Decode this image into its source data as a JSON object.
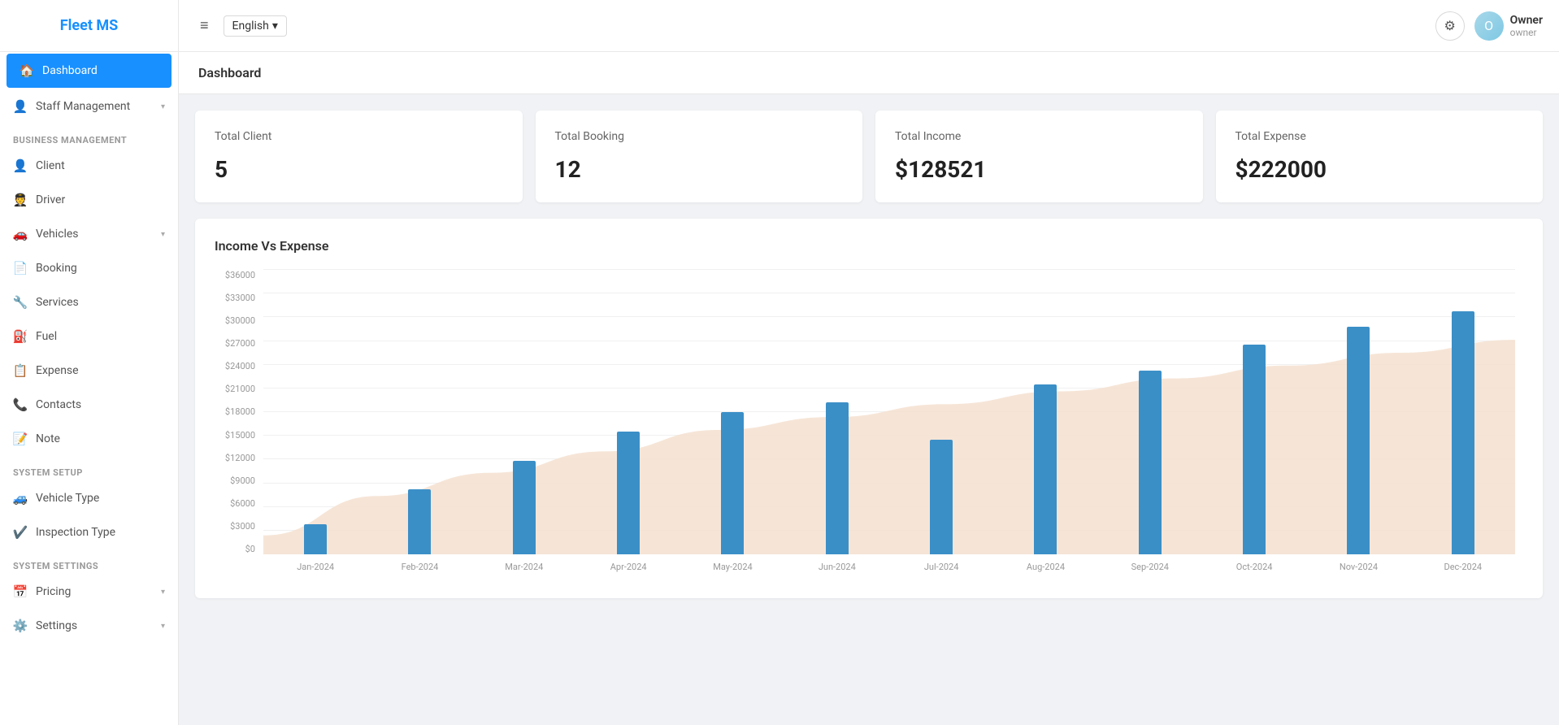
{
  "sidebar": {
    "logo": "Fleet MS",
    "items": [
      {
        "id": "dashboard",
        "label": "Dashboard",
        "icon": "🏠",
        "active": true,
        "hasArrow": false
      },
      {
        "id": "staff-management",
        "label": "Staff Management",
        "icon": "👤",
        "active": false,
        "hasArrow": true
      },
      {
        "id": "section-business",
        "label": "Business Management",
        "isSection": true
      },
      {
        "id": "client",
        "label": "Client",
        "icon": "👤",
        "active": false,
        "hasArrow": false
      },
      {
        "id": "driver",
        "label": "Driver",
        "icon": "🧑‍✈️",
        "active": false,
        "hasArrow": false
      },
      {
        "id": "vehicles",
        "label": "Vehicles",
        "icon": "🚗",
        "active": false,
        "hasArrow": true
      },
      {
        "id": "booking",
        "label": "Booking",
        "icon": "📄",
        "active": false,
        "hasArrow": false
      },
      {
        "id": "services",
        "label": "Services",
        "icon": "🔧",
        "active": false,
        "hasArrow": false
      },
      {
        "id": "fuel",
        "label": "Fuel",
        "icon": "⛽",
        "active": false,
        "hasArrow": false
      },
      {
        "id": "expense",
        "label": "Expense",
        "icon": "📋",
        "active": false,
        "hasArrow": false
      },
      {
        "id": "contacts",
        "label": "Contacts",
        "icon": "📞",
        "active": false,
        "hasArrow": false
      },
      {
        "id": "note",
        "label": "Note",
        "icon": "📝",
        "active": false,
        "hasArrow": false
      },
      {
        "id": "section-setup",
        "label": "System Setup",
        "isSection": true
      },
      {
        "id": "vehicle-type",
        "label": "Vehicle Type",
        "icon": "🚙",
        "active": false,
        "hasArrow": false
      },
      {
        "id": "inspection-type",
        "label": "Inspection Type",
        "icon": "✔️",
        "active": false,
        "hasArrow": false
      },
      {
        "id": "section-settings",
        "label": "System Settings",
        "isSection": true
      },
      {
        "id": "pricing",
        "label": "Pricing",
        "icon": "📅",
        "active": false,
        "hasArrow": true
      },
      {
        "id": "settings",
        "label": "Settings",
        "icon": "⚙️",
        "active": false,
        "hasArrow": true
      }
    ]
  },
  "topbar": {
    "hamburger_icon": "≡",
    "language": "English",
    "language_arrow": "▾",
    "gear_icon": "⚙",
    "user": {
      "name": "Owner",
      "role": "owner",
      "avatar_initials": "O"
    }
  },
  "page": {
    "title": "Dashboard"
  },
  "stats": [
    {
      "label": "Total Client",
      "value": "5"
    },
    {
      "label": "Total Booking",
      "value": "12"
    },
    {
      "label": "Total Income",
      "value": "$128521"
    },
    {
      "label": "Total Expense",
      "value": "$222000"
    }
  ],
  "chart": {
    "title": "Income Vs Expense",
    "y_labels": [
      "$0",
      "$3000",
      "$6000",
      "$9000",
      "$12000",
      "$15000",
      "$18000",
      "$21000",
      "$24000",
      "$27000",
      "$30000",
      "$33000",
      "$36000"
    ],
    "max_value": 36000,
    "months": [
      {
        "label": "Jan-2024",
        "income": 3800,
        "expense": 2200
      },
      {
        "label": "Feb-2024",
        "income": 8200,
        "expense": 6800
      },
      {
        "label": "Mar-2024",
        "income": 11800,
        "expense": 9500
      },
      {
        "label": "Apr-2024",
        "income": 15500,
        "expense": 12000
      },
      {
        "label": "May-2024",
        "income": 18000,
        "expense": 14500
      },
      {
        "label": "Jun-2024",
        "income": 19200,
        "expense": 16000
      },
      {
        "label": "Jul-2024",
        "income": 14500,
        "expense": 17500
      },
      {
        "label": "Aug-2024",
        "income": 21500,
        "expense": 19000
      },
      {
        "label": "Sep-2024",
        "income": 23200,
        "expense": 20500
      },
      {
        "label": "Oct-2024",
        "income": 26500,
        "expense": 22000
      },
      {
        "label": "Nov-2024",
        "income": 28800,
        "expense": 23500
      },
      {
        "label": "Dec-2024",
        "income": 30800,
        "expense": 25000
      }
    ]
  },
  "colors": {
    "primary": "#1890ff",
    "sidebar_active": "#1890ff",
    "bar_income": "#3b8fc7",
    "expense_area": "#f5e0d0"
  }
}
